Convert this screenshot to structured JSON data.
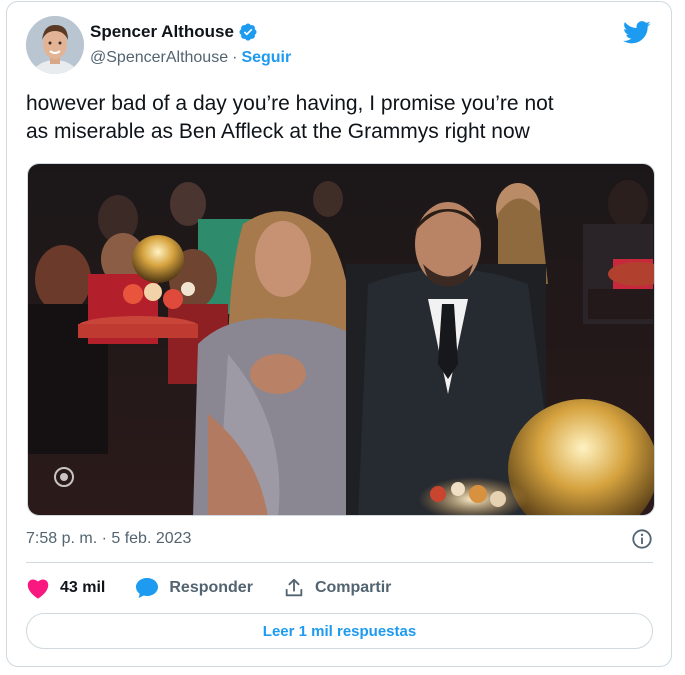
{
  "author": {
    "name": "Spencer Althouse",
    "handle": "@SpencerAlthouse",
    "separator": "·",
    "follow_label": "Seguir",
    "verified": true
  },
  "tweet": {
    "text": "however bad of a day you’re having, I promise you’re not\nas miserable as Ben Affleck at the Grammys right now",
    "timestamp": "7:58 p. m. · 5 feb. 2023"
  },
  "media": {
    "type": "photo",
    "watermark_icon": "cbs-eye-icon"
  },
  "actions": {
    "likes_count": "43 mil",
    "reply_label": "Responder",
    "share_label": "Compartir"
  },
  "replies_button": "Leer 1 mil respuestas",
  "icons": {
    "brand": "twitter-bird-icon",
    "verified": "verified-badge-icon",
    "info": "info-icon",
    "like": "heart-icon",
    "reply": "speech-bubble-icon",
    "share": "share-icon"
  },
  "colors": {
    "accent": "#1d9bf0",
    "like": "#f91880",
    "text": "#0f1419",
    "secondary": "#536471",
    "border": "#cfd9de"
  }
}
